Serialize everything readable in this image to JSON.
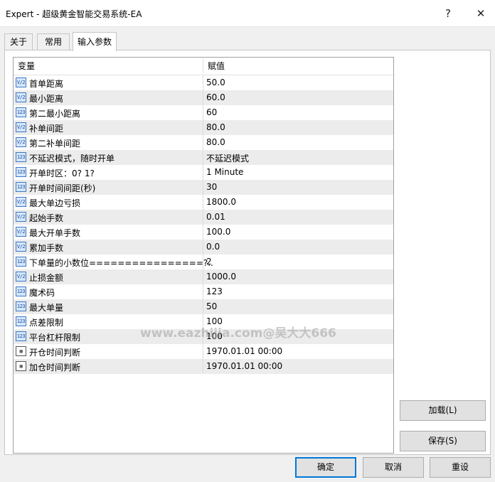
{
  "window": {
    "title": "Expert - 超级黄金智能交易系统-EA",
    "help_glyph": "?",
    "close_glyph": "✕"
  },
  "tabs": [
    {
      "label": "关于"
    },
    {
      "label": "常用"
    },
    {
      "label": "输入参数",
      "active": true
    }
  ],
  "table": {
    "headers": {
      "variable": "变量",
      "value": "赋值"
    },
    "rows": [
      {
        "icon": "double-value-icon",
        "icon_text": "V/2",
        "name": "首单距离",
        "value": "50.0"
      },
      {
        "icon": "double-value-icon",
        "icon_text": "V/2",
        "name": "最小距离",
        "value": "60.0"
      },
      {
        "icon": "integer-value-icon",
        "icon_text": "123",
        "name": "第二最小距离",
        "value": "60"
      },
      {
        "icon": "double-value-icon",
        "icon_text": "V/2",
        "name": "补单间距",
        "value": "80.0"
      },
      {
        "icon": "double-value-icon",
        "icon_text": "V/2",
        "name": "第二补单间距",
        "value": "80.0"
      },
      {
        "icon": "integer-value-icon",
        "icon_text": "123",
        "name": "不延迟模式，随时开单",
        "value": "不延迟模式"
      },
      {
        "icon": "integer-value-icon",
        "icon_text": "123",
        "name": "开单时区：0? 1?",
        "value": "1 Minute"
      },
      {
        "icon": "integer-value-icon",
        "icon_text": "123",
        "name": "开单时间间距(秒)",
        "value": "30"
      },
      {
        "icon": "double-value-icon",
        "icon_text": "V/2",
        "name": "最大单边亏损",
        "value": "1800.0"
      },
      {
        "icon": "double-value-icon",
        "icon_text": "V/2",
        "name": "起始手数",
        "value": "0.01"
      },
      {
        "icon": "double-value-icon",
        "icon_text": "V/2",
        "name": "最大开单手数",
        "value": "100.0"
      },
      {
        "icon": "double-value-icon",
        "icon_text": "V/2",
        "name": "累加手数",
        "value": "0.0"
      },
      {
        "icon": "integer-value-icon",
        "icon_text": "123",
        "name": "下单量的小数位================?..",
        "value": "2"
      },
      {
        "icon": "double-value-icon",
        "icon_text": "V/2",
        "name": "止损金额",
        "value": "1000.0"
      },
      {
        "icon": "integer-value-icon",
        "icon_text": "123",
        "name": "魔术码",
        "value": "123"
      },
      {
        "icon": "integer-value-icon",
        "icon_text": "123",
        "name": "最大单量",
        "value": "50"
      },
      {
        "icon": "integer-value-icon",
        "icon_text": "123",
        "name": "点差限制",
        "value": "100"
      },
      {
        "icon": "integer-value-icon",
        "icon_text": "123",
        "name": "平台杠杆限制",
        "value": "100"
      },
      {
        "icon": "datetime-value-icon",
        "icon_text": "▦",
        "name": "开仓时间判断",
        "value": "1970.01.01 00:00"
      },
      {
        "icon": "datetime-value-icon",
        "icon_text": "▦",
        "name": "加仓时间判断",
        "value": "1970.01.01 00:00"
      }
    ]
  },
  "watermark": "www.eazhijia.com@吴大大666",
  "side_buttons": {
    "load": "加载(L)",
    "save": "保存(S)"
  },
  "footer_buttons": {
    "ok": "确定",
    "cancel": "取消",
    "reset": "重设"
  }
}
